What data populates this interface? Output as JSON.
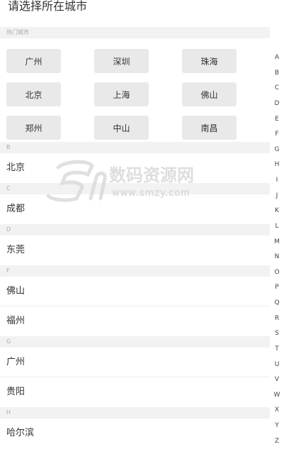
{
  "header": {
    "title": "请选择所在城市"
  },
  "hot_cities": {
    "header": "热门城市",
    "items": [
      "广州",
      "深圳",
      "珠海",
      "北京",
      "上海",
      "佛山",
      "郑州",
      "中山",
      "南昌"
    ]
  },
  "sections": [
    {
      "letter": "B",
      "cities": [
        "北京"
      ]
    },
    {
      "letter": "C",
      "cities": [
        "成都"
      ]
    },
    {
      "letter": "D",
      "cities": [
        "东莞"
      ]
    },
    {
      "letter": "F",
      "cities": [
        "佛山",
        "福州"
      ]
    },
    {
      "letter": "G",
      "cities": [
        "广州",
        "贵阳"
      ]
    },
    {
      "letter": "H",
      "cities": [
        "哈尔滨"
      ]
    }
  ],
  "index_letters": [
    "A",
    "B",
    "C",
    "D",
    "E",
    "F",
    "G",
    "H",
    "I",
    "J",
    "K",
    "L",
    "M",
    "N",
    "O",
    "P",
    "Q",
    "R",
    "S",
    "T",
    "U",
    "V",
    "W",
    "X",
    "Y",
    "Z"
  ],
  "watermark": {
    "brand": "数码资源网",
    "url": "www.smzy.com"
  }
}
